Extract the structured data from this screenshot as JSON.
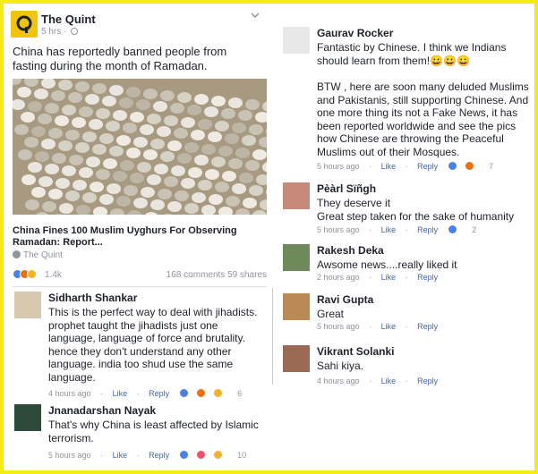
{
  "post": {
    "page_name": "The Quint",
    "time": "5 hrs",
    "text": "China has reportedly banned people from fasting during the month of Ramadan.",
    "link_title": "China Fines 100 Muslim Uyghurs For Observing Ramadan: Report...",
    "link_source": "The Quint",
    "reaction_count": "1.4k",
    "comments_shares": "168 comments  59 shares"
  },
  "left_comments": [
    {
      "name": "Sidharth Shankar",
      "text": "This is the perfect way to deal with jihadists. prophet taught the jihadists just one language, language of force and brutality. hence they don't understand any other language. india too shud use the same language.",
      "time": "4 hours ago",
      "like": "Like",
      "reply": "Reply",
      "reactions": "6"
    },
    {
      "name": "Jnanadarshan Nayak",
      "text": "That's why China is least affected by Islamic terrorism.",
      "time": "5 hours ago",
      "like": "Like",
      "reply": "Reply",
      "reactions": "10"
    }
  ],
  "right_comments": [
    {
      "name": "Gaurav Rocker",
      "text1": "Fantastic by Chinese. I think we Indians should learn from them!😀😀😀",
      "text2": "BTW , here are soon many deluded Muslims and Pakistanis, still supporting Chinese. And one more thing its not a Fake News, it has been reported worldwide and see the pics how Chinese are throwing the Peaceful Muslims out of their Mosques.",
      "time": "5 hours ago",
      "like": "Like",
      "reply": "Reply",
      "reactions": "7"
    },
    {
      "name": "Pèàrl Sïñgh",
      "text": "They deserve it\nGreat step taken for the sake of humanity",
      "time": "5 hours ago",
      "like": "Like",
      "reply": "Reply",
      "reactions": "2"
    },
    {
      "name": "Rakesh Deka",
      "text": "Awsome news....really liked it",
      "time": "2 hours ago",
      "like": "Like",
      "reply": "Reply"
    },
    {
      "name": "Ravi Gupta",
      "text": "Great",
      "time": "5 hours ago",
      "like": "Like",
      "reply": "Reply"
    },
    {
      "name": "Vikrant Solanki",
      "text": "Sahi kiya.",
      "time": "4 hours ago",
      "like": "Like",
      "reply": "Reply"
    }
  ],
  "colors": {
    "border": "#f5ea14",
    "link_blue": "#4267b2",
    "meta_gray": "#90949c",
    "like_blue": "#4a80e8"
  },
  "icons": [
    "quint-logo-icon",
    "globe-icon",
    "chevron-down-icon",
    "like-icon",
    "haha-icon",
    "angry-icon",
    "love-icon"
  ]
}
